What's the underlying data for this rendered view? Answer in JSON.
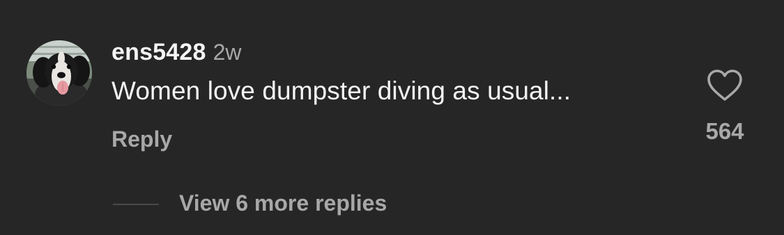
{
  "comment": {
    "username": "ens5428",
    "timestamp": "2w",
    "text": "Women love dumpster diving as usual...",
    "reply_label": "Reply",
    "like_count": "564",
    "like_icon": "heart-outline-icon",
    "avatar": "profile-photo-dog"
  },
  "replies": {
    "view_more_label": "View 6 more replies"
  },
  "colors": {
    "background": "#262626",
    "primary_text": "#f5f5f5",
    "secondary_text": "#a8a8a8",
    "thread_line": "#4a4a4a"
  }
}
